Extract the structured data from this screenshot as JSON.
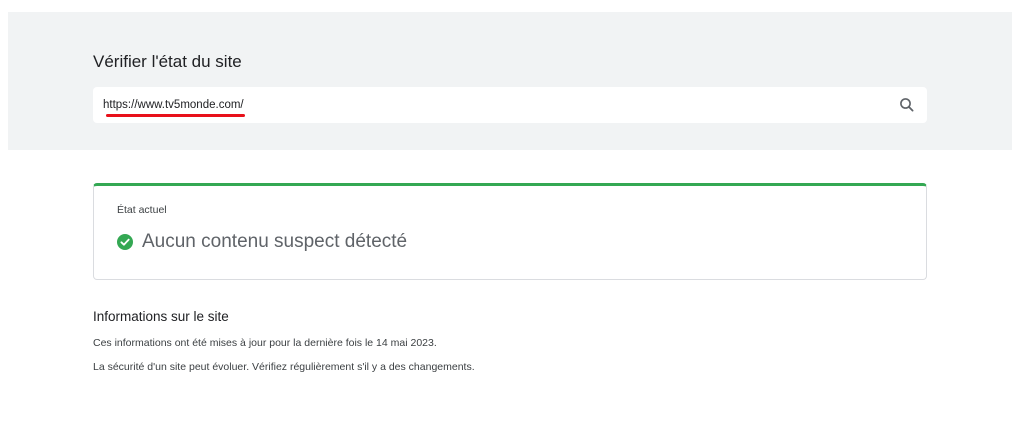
{
  "search": {
    "title": "Vérifier l'état du site",
    "value": "https://www.tv5monde.com/",
    "annotation_color": "#e8101a"
  },
  "status": {
    "label": "État actuel",
    "text": "Aucun contenu suspect détecté",
    "icon": "check-circle-icon",
    "accent_color": "#34a853"
  },
  "info": {
    "heading": "Informations sur le site",
    "lines": [
      "Ces informations ont été mises à jour pour la dernière fois le 14 mai 2023.",
      "La sécurité d'un site peut évoluer. Vérifiez régulièrement s'il y a des changements."
    ]
  },
  "icons": {
    "search_button": "search-icon"
  }
}
